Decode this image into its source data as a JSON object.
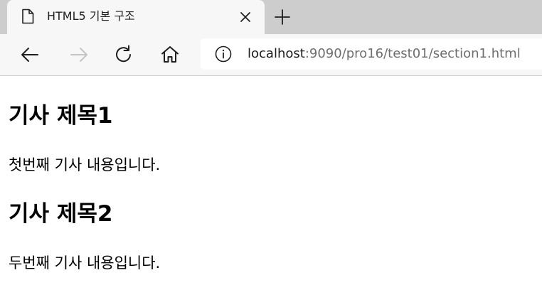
{
  "browser": {
    "tab": {
      "title": "HTML5 기본 구조",
      "icon": "page-icon"
    },
    "address": {
      "host": "localhost",
      "path": ":9090/pro16/test01/section1.html"
    }
  },
  "page": {
    "articles": [
      {
        "heading": "기사 제목1",
        "body": "첫번째 기사 내용입니다."
      },
      {
        "heading": "기사 제목2",
        "body": "두번째 기사 내용입니다."
      }
    ]
  }
}
